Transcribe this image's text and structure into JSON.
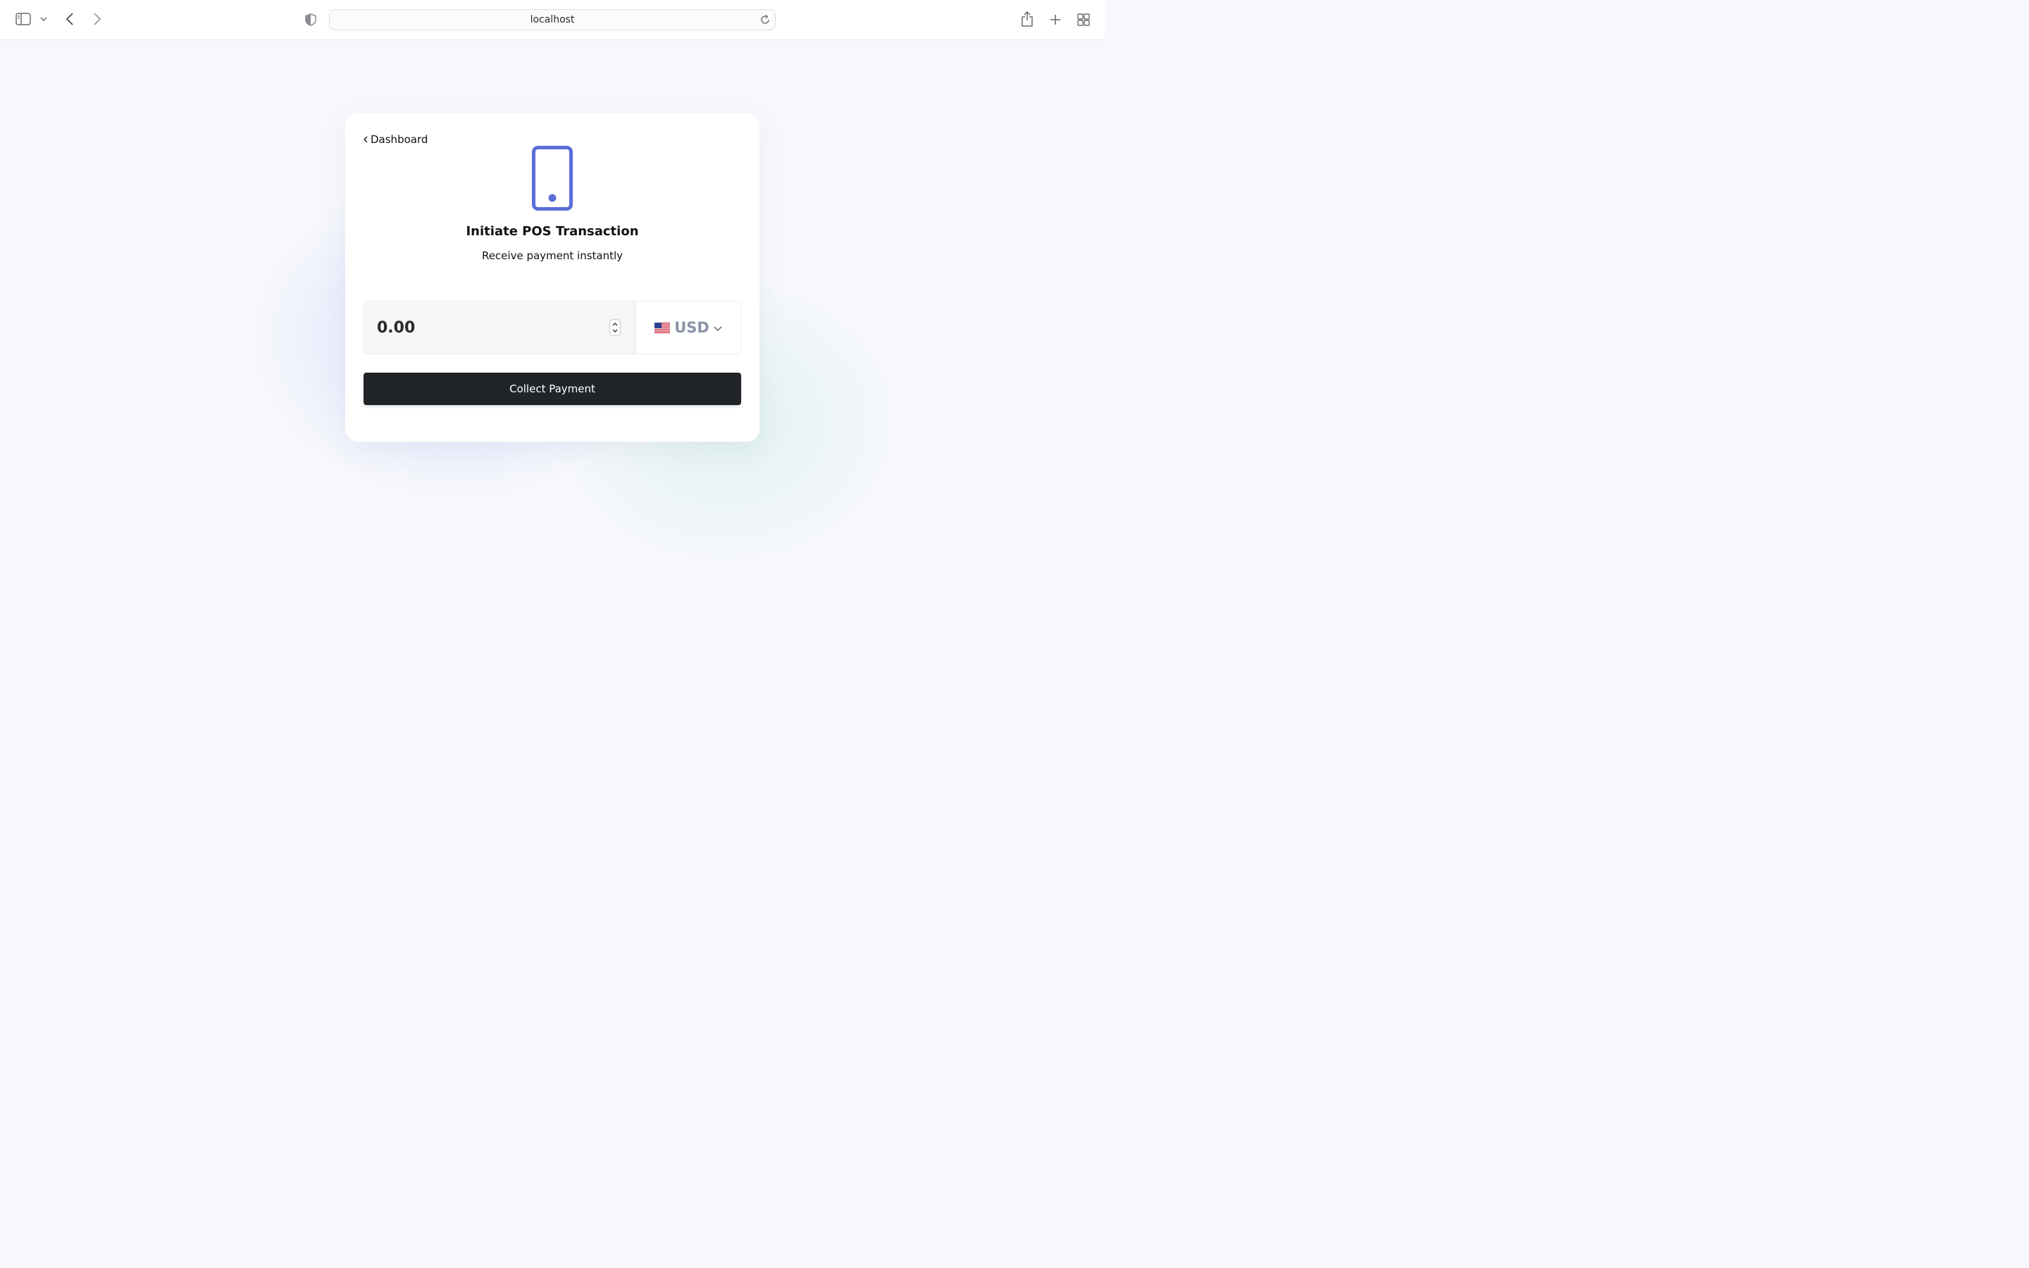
{
  "browser": {
    "url": "localhost",
    "icons": [
      "sidebar-icon",
      "chevron-down-icon",
      "back-arrow-icon",
      "forward-arrow-icon",
      "shield-icon",
      "reload-icon",
      "share-icon",
      "new-tab-icon",
      "tab-overview-icon"
    ]
  },
  "card": {
    "back_label": "Dashboard",
    "title": "Initiate POS Transaction",
    "subtitle": "Receive payment instantly",
    "amount_placeholder": "0.00",
    "currency_code": "USD",
    "currency_flag": "us-flag-icon",
    "button_label": "Collect Payment"
  },
  "colors": {
    "accent": "#5b6fd8",
    "button_bg": "#212529",
    "currency_text": "#8a93a6"
  }
}
